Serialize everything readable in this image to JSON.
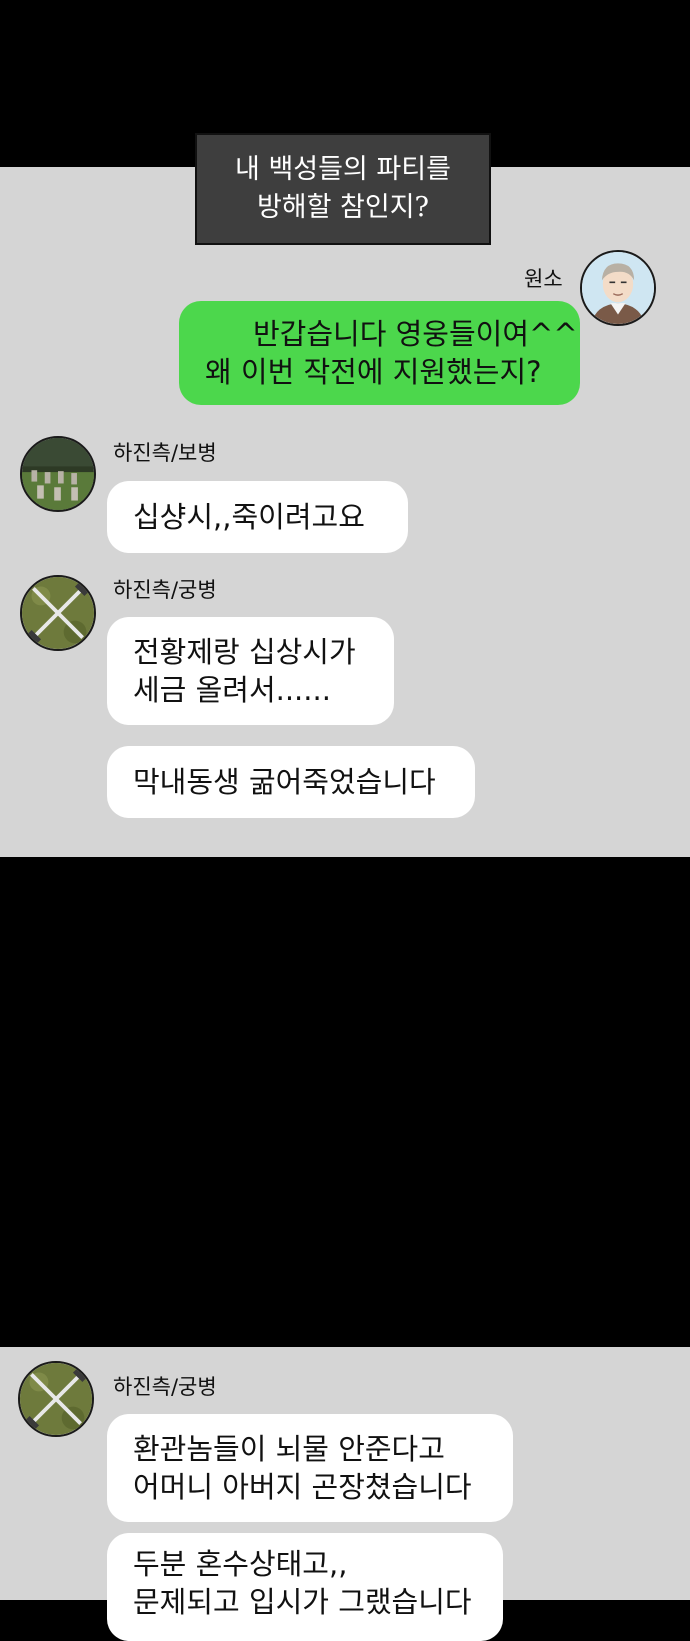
{
  "caption": {
    "line1": "내 백성들의 파티를",
    "line2": "방해할 참인지?"
  },
  "messages": [
    {
      "sender": "원소",
      "lines": [
        "반갑습니다 영웅들이여^^",
        "왜 이번 작전에 지원했는지?"
      ]
    },
    {
      "sender": "하진측/보병",
      "lines": [
        "십샹시,,죽이려고요"
      ]
    },
    {
      "sender": "하진측/궁병",
      "lines": [
        "전황제랑 십상시가",
        "세금 올려서......"
      ]
    },
    {
      "sender": "",
      "lines": [
        "막내동생 굶어죽었습니다"
      ]
    },
    {
      "sender": "하진측/궁병",
      "lines": [
        "환관놈들이 뇌물 안준다고",
        "어머니 아버지 곤장쳤습니다"
      ]
    },
    {
      "sender": "",
      "lines": [
        "두분 혼수상태고,,",
        "문제되고 입시가 그랬습니다"
      ]
    }
  ],
  "colors": {
    "background": "#d5d5d5",
    "my_bubble": "#4cd74c",
    "other_bubble": "#ffffff",
    "caption_box": "#3e3e3e"
  },
  "icons": {
    "wonso_avatar": "man-portrait-icon",
    "infantry_avatar": "graveyard-icon",
    "archer_avatar": "crossed-swords-icon"
  }
}
